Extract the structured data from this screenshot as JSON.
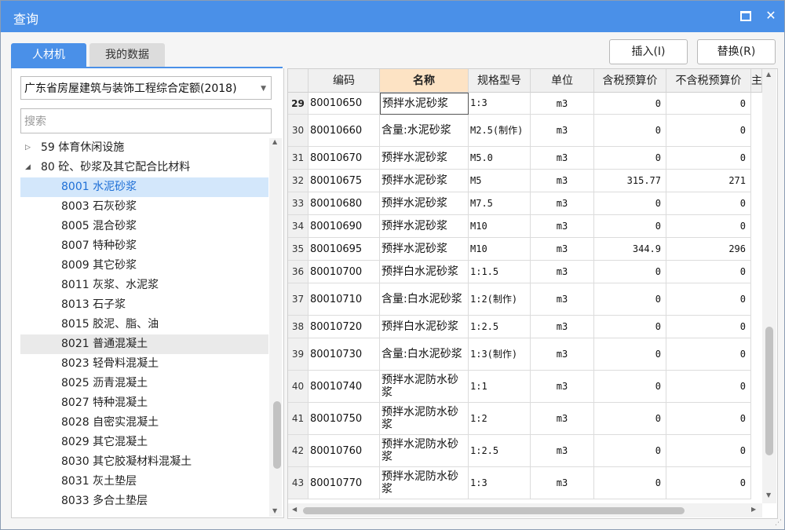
{
  "window": {
    "title": "查询"
  },
  "tabs": [
    {
      "label": "人材机"
    },
    {
      "label": "我的数据"
    }
  ],
  "buttons": {
    "insert": "插入(I)",
    "replace": "替换(R)"
  },
  "combo": {
    "value": "广东省房屋建筑与装饰工程综合定额(2018)"
  },
  "search": {
    "placeholder": "搜索"
  },
  "tree": {
    "items": [
      {
        "label": "59 体育休闲设施",
        "level": 0,
        "expanded": false
      },
      {
        "label": "80 砼、砂浆及其它配合比材料",
        "level": 0,
        "expanded": true
      },
      {
        "label": "8001 水泥砂浆",
        "level": 1,
        "selected": true
      },
      {
        "label": "8003 石灰砂浆",
        "level": 1
      },
      {
        "label": "8005 混合砂浆",
        "level": 1
      },
      {
        "label": "8007 特种砂浆",
        "level": 1
      },
      {
        "label": "8009 其它砂浆",
        "level": 1
      },
      {
        "label": "8011 灰浆、水泥浆",
        "level": 1
      },
      {
        "label": "8013 石子浆",
        "level": 1
      },
      {
        "label": "8015 胶泥、脂、油",
        "level": 1
      },
      {
        "label": "8021 普通混凝土",
        "level": 1,
        "hover": true
      },
      {
        "label": "8023 轻骨料混凝土",
        "level": 1
      },
      {
        "label": "8025 沥青混凝土",
        "level": 1
      },
      {
        "label": "8027 特种混凝土",
        "level": 1
      },
      {
        "label": "8028 自密实混凝土",
        "level": 1
      },
      {
        "label": "8029 其它混凝土",
        "level": 1
      },
      {
        "label": "8030 其它胶凝材料混凝土",
        "level": 1
      },
      {
        "label": "8031 灰土垫层",
        "level": 1
      },
      {
        "label": "8033 多合土垫层",
        "level": 1
      }
    ]
  },
  "table": {
    "headers": [
      "编码",
      "名称",
      "规格型号",
      "单位",
      "含税预算价",
      "不含税预算价",
      "主"
    ],
    "rows": [
      {
        "idx": "29",
        "code": "80010650",
        "name": "预拌水泥砂浆",
        "spec": "1:3",
        "unit": "m3",
        "p1": "0",
        "p2": "0"
      },
      {
        "idx": "30",
        "code": "80010660",
        "name": "含量:水泥砂浆",
        "spec": "M2.5(制作)",
        "unit": "m3",
        "p1": "0",
        "p2": "0"
      },
      {
        "idx": "31",
        "code": "80010670",
        "name": "预拌水泥砂浆",
        "spec": "M5.0",
        "unit": "m3",
        "p1": "0",
        "p2": "0"
      },
      {
        "idx": "32",
        "code": "80010675",
        "name": "预拌水泥砂浆",
        "spec": "M5",
        "unit": "m3",
        "p1": "315.77",
        "p2": "271"
      },
      {
        "idx": "33",
        "code": "80010680",
        "name": "预拌水泥砂浆",
        "spec": "M7.5",
        "unit": "m3",
        "p1": "0",
        "p2": "0"
      },
      {
        "idx": "34",
        "code": "80010690",
        "name": "预拌水泥砂浆",
        "spec": "M10",
        "unit": "m3",
        "p1": "0",
        "p2": "0"
      },
      {
        "idx": "35",
        "code": "80010695",
        "name": "预拌水泥砂浆",
        "spec": "M10",
        "unit": "m3",
        "p1": "344.9",
        "p2": "296"
      },
      {
        "idx": "36",
        "code": "80010700",
        "name": "预拌白水泥砂浆",
        "spec": "1:1.5",
        "unit": "m3",
        "p1": "0",
        "p2": "0"
      },
      {
        "idx": "37",
        "code": "80010710",
        "name": "含量:白水泥砂浆",
        "spec": "1:2(制作)",
        "unit": "m3",
        "p1": "0",
        "p2": "0"
      },
      {
        "idx": "38",
        "code": "80010720",
        "name": "预拌白水泥砂浆",
        "spec": "1:2.5",
        "unit": "m3",
        "p1": "0",
        "p2": "0"
      },
      {
        "idx": "39",
        "code": "80010730",
        "name": "含量:白水泥砂浆",
        "spec": "1:3(制作)",
        "unit": "m3",
        "p1": "0",
        "p2": "0"
      },
      {
        "idx": "40",
        "code": "80010740",
        "name": "预拌水泥防水砂浆",
        "spec": "1:1",
        "unit": "m3",
        "p1": "0",
        "p2": "0"
      },
      {
        "idx": "41",
        "code": "80010750",
        "name": "预拌水泥防水砂浆",
        "spec": "1:2",
        "unit": "m3",
        "p1": "0",
        "p2": "0"
      },
      {
        "idx": "42",
        "code": "80010760",
        "name": "预拌水泥防水砂浆",
        "spec": "1:2.5",
        "unit": "m3",
        "p1": "0",
        "p2": "0"
      },
      {
        "idx": "43",
        "code": "80010770",
        "name": "预拌水泥防水砂浆",
        "spec": "1:3",
        "unit": "m3",
        "p1": "0",
        "p2": "0"
      }
    ]
  },
  "colors": {
    "accent": "#4a90e8",
    "name_header_bg": "#fde3c4",
    "tree_selected_bg": "#d3e7fb",
    "tree_selected_text": "#1e6fd6"
  },
  "icons": {
    "maximize": "maximize-icon",
    "close": "close-icon",
    "combo_arrow": "chevron-down-icon"
  }
}
